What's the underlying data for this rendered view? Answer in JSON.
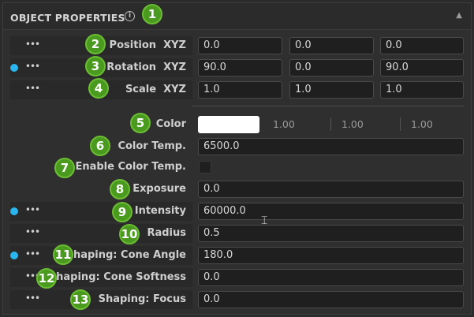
{
  "header": {
    "title": "OBJECT PROPERTIES",
    "info_icon": "info-icon",
    "collapse_icon": "chevron-up-icon"
  },
  "badges": [
    "1",
    "2",
    "3",
    "4",
    "5",
    "6",
    "7",
    "8",
    "9",
    "10",
    "11",
    "12",
    "13"
  ],
  "transform": {
    "position": {
      "label": "Position",
      "axis": "XYZ",
      "x": "0.0",
      "y": "0.0",
      "z": "0.0"
    },
    "rotation": {
      "label": "Rotation",
      "axis": "XYZ",
      "x": "90.0",
      "y": "0.0",
      "z": "90.0"
    },
    "scale": {
      "label": "Scale",
      "axis": "XYZ",
      "x": "1.0",
      "y": "1.0",
      "z": "1.0"
    }
  },
  "light": {
    "color": {
      "label": "Color",
      "r": "1.00",
      "g": "1.00",
      "b": "1.00",
      "swatch": "#ffffff"
    },
    "color_temp": {
      "label": "Color Temp.",
      "value": "6500.0"
    },
    "enable_color_temp": {
      "label": "Enable Color Temp.",
      "checked": false
    },
    "exposure": {
      "label": "Exposure",
      "value": "0.0"
    },
    "intensity": {
      "label": "Intensity",
      "value": "60000.0"
    },
    "radius": {
      "label": "Radius",
      "value": "0.5"
    },
    "cone_angle": {
      "label": "Shaping: Cone Angle",
      "value": "180.0"
    },
    "cone_softness": {
      "label": "Shaping: Cone Softness",
      "value": "0.0"
    },
    "focus": {
      "label": "Shaping: Focus",
      "value": "0.0"
    }
  },
  "dots_glyph": "•••",
  "colors": {
    "accent_dot": "#2bb5ee",
    "badge": "#4a9a1f"
  }
}
